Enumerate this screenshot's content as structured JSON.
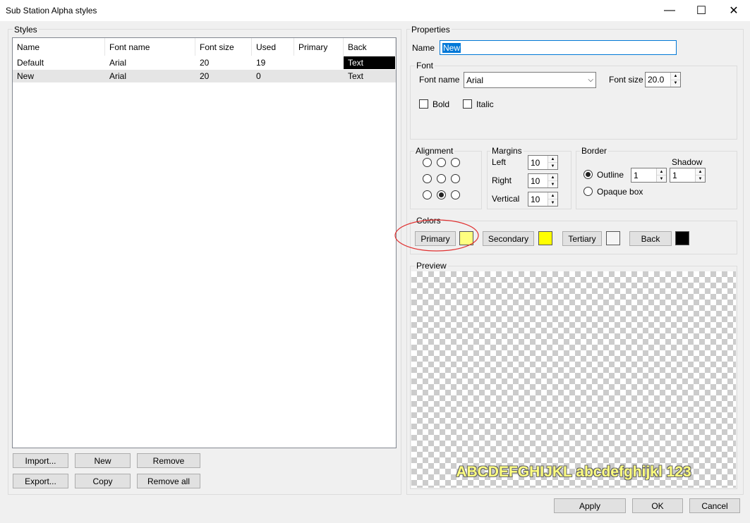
{
  "window": {
    "title": "Sub Station Alpha styles",
    "min": "—",
    "max": "☐",
    "close": "✕"
  },
  "styles": {
    "label": "Styles",
    "columns": [
      "Name",
      "Font name",
      "Font size",
      "Used",
      "Primary",
      "Back"
    ],
    "rows": [
      {
        "name": "Default",
        "font": "Arial",
        "size": "20",
        "used": "19",
        "primary": "",
        "back": "Text"
      },
      {
        "name": "New",
        "font": "Arial",
        "size": "20",
        "used": "0",
        "primary": "",
        "back": "Text"
      }
    ],
    "buttons": {
      "import": "Import...",
      "new": "New",
      "remove": "Remove",
      "export": "Export...",
      "copy": "Copy",
      "remove_all": "Remove all"
    }
  },
  "properties": {
    "label": "Properties",
    "name_label": "Name",
    "name_value": "New",
    "font": {
      "label": "Font",
      "font_name_label": "Font name",
      "font_name_value": "Arial",
      "font_size_label": "Font size",
      "font_size_value": "20.0",
      "bold_label": "Bold",
      "italic_label": "Italic",
      "bold_checked": false,
      "italic_checked": false
    },
    "alignment": {
      "label": "Alignment",
      "selected": "bottom-center"
    },
    "margins": {
      "label": "Margins",
      "left_label": "Left",
      "left_value": "10",
      "right_label": "Right",
      "right_value": "10",
      "vertical_label": "Vertical",
      "vertical_value": "10"
    },
    "border": {
      "label": "Border",
      "shadow_label": "Shadow",
      "outline_label": "Outline",
      "outline_value": "1",
      "shadow_value": "1",
      "opaque_label": "Opaque box",
      "selected": "outline"
    },
    "colors": {
      "label": "Colors",
      "primary_label": "Primary",
      "primary_color": "#ffff80",
      "secondary_label": "Secondary",
      "secondary_color": "#ffff00",
      "tertiary_label": "Tertiary",
      "tertiary_color": "#f5f5f5",
      "back_label": "Back",
      "back_color": "#000000",
      "highlight_color": "#e03030"
    },
    "preview": {
      "label": "Preview",
      "text": "ABCDEFGHIJKL abcdefghijkl 123"
    }
  },
  "footer": {
    "apply": "Apply",
    "ok": "OK",
    "cancel": "Cancel"
  }
}
